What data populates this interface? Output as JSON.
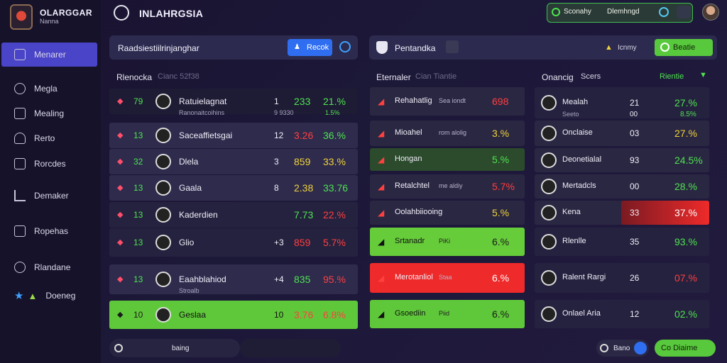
{
  "brand": {
    "title": "OLARGGAR",
    "subtitle": "Nanna"
  },
  "sidebar": {
    "items": [
      {
        "label": "Menarer",
        "icon": "square-icon",
        "active": true
      },
      {
        "label": "Megla",
        "icon": "globe-icon"
      },
      {
        "label": "Mealing",
        "icon": "document-icon"
      },
      {
        "label": "Rerto",
        "icon": "people-icon"
      },
      {
        "label": "Rorcdes",
        "icon": "calendar-icon"
      },
      {
        "label": "Demaker",
        "icon": "chart-icon"
      },
      {
        "label": "Ropehas",
        "icon": "list-icon"
      },
      {
        "label": "Rlandane",
        "icon": "settings-icon"
      },
      {
        "label": "Doeneg",
        "icon": "star-icon"
      }
    ]
  },
  "header": {
    "title": "INLAHRGSIA",
    "pill_label": "Sconahy",
    "pill_value": "Dlemhngd"
  },
  "left_panel": {
    "title": "Raadsiestiilrinjanghar",
    "button": "Recok",
    "section_title": "Rlenocka",
    "section_sub": "Cianc 52f38",
    "rows": [
      {
        "rank": "79",
        "name": "Ratuielagnat",
        "sub": "Ranonaitcoihins",
        "c1": "1",
        "c2": "233",
        "c3": "21.%",
        "sub2": "9 9330",
        "sub3": "1.5%",
        "c2color": "#4ee34f",
        "c3color": "#4ee34f",
        "bg": "#1e1b35"
      },
      {
        "rank": "13",
        "name": "Saceaffietsgai",
        "sub": "",
        "c1": "12",
        "c2": "3.26",
        "c3": "36.%",
        "c2color": "#ff3f3f",
        "c3color": "#4ee34f",
        "bg": "#2e2b4d"
      },
      {
        "rank": "32",
        "name": "Dlela",
        "sub": "",
        "c1": "3",
        "c2": "859",
        "c3": "33.%",
        "c2color": "#f0d23a",
        "c3color": "#f0d23a",
        "bg": "#2e2b4d"
      },
      {
        "rank": "13",
        "name": "Gaala",
        "sub": "",
        "c1": "8",
        "c2": "2.38",
        "c3": "33.76",
        "c2color": "#f0d23a",
        "c3color": "#4ee34f",
        "bg": "#2e2b4d"
      },
      {
        "rank": "13",
        "name": "Kaderdien",
        "sub": "",
        "c1": "",
        "c2": "7.73",
        "c3": "22.%",
        "c2color": "#4ee34f",
        "c3color": "#ff3f3f",
        "bg": "#25223f"
      },
      {
        "rank": "13",
        "name": "Glio",
        "sub": "",
        "c1": "+3",
        "c2": "859",
        "c3": "5.7%",
        "c2color": "#ff3f3f",
        "c3color": "#ff3f3f",
        "bg": "#25223f"
      },
      {
        "rank": "13",
        "name": "Eaahblahiod",
        "sub": "Stroalb",
        "c1": "+4",
        "c2": "835",
        "c3": "95.%",
        "c2color": "#4ee34f",
        "c3color": "#ff3f3f",
        "bg": "#2e2b4d"
      },
      {
        "rank": "10",
        "name": "Geslaa",
        "sub": "",
        "c1": "10",
        "c2": "3.76",
        "c3": "6.8%",
        "c2color": "#ff3f3f",
        "c3color": "#ff3f3f",
        "bg": "#5fc83a"
      }
    ],
    "footer_label": "baing"
  },
  "mid_panel": {
    "title": "Pentandka",
    "section_title": "Eternaler",
    "section_sub": "Cian Tiantie",
    "rows": [
      {
        "name": "Rehahatlig",
        "sub": "Sea iondt",
        "value": "698",
        "color": "#ff3f3f",
        "bg": "#2a2742"
      },
      {
        "name": "Mioahel",
        "sub": "rom alolig",
        "value": "3.%",
        "color": "#f0d23a",
        "bg": "#2a2742"
      },
      {
        "name": "Hongan",
        "sub": "",
        "value": "5.%",
        "color": "#4ee34f",
        "bg": "#2c4a2c"
      },
      {
        "name": "Retalchtel",
        "sub": "me aldiy",
        "value": "5.7%",
        "color": "#ff3f3f",
        "bg": "#2a2742"
      },
      {
        "name": "Oolahbiiooing",
        "sub": "",
        "value": "5.%",
        "color": "#f0d23a",
        "bg": "#2a2742"
      },
      {
        "name": "Srtanadr",
        "sub": "PiKi",
        "value": "6.%",
        "color": "#1a1a1a",
        "bg": "#66cc3a"
      },
      {
        "name": "Merotanliol",
        "sub": "Staa",
        "value": "6.%",
        "color": "#ffffff",
        "bg": "#ee2a2a"
      },
      {
        "name": "Gsoediin",
        "sub": "Piid",
        "value": "6.%",
        "color": "#1a1a1a",
        "bg": "#5fc83a"
      }
    ]
  },
  "right_panel": {
    "warn": "Icnmy",
    "button": "Beatie",
    "section_title": "Onancig",
    "section_sub": "Scers",
    "filter": "Rientie",
    "rows": [
      {
        "name": "Mealah",
        "sub": "Seeto",
        "c1": "21",
        "c1b": "00",
        "c2": "27.%",
        "c2b": "8.5%",
        "color": "#4ee34f",
        "bg": "#25223f"
      },
      {
        "name": "Onclaise",
        "sub": "",
        "c1": "03",
        "c2": "27.%",
        "color": "#f0d23a",
        "bg": "#2a2742"
      },
      {
        "name": "Deonetialal",
        "sub": "",
        "c1": "93",
        "c2": "24.5%",
        "color": "#4ee34f",
        "bg": "#2a2742"
      },
      {
        "name": "Mertadcls",
        "sub": "",
        "c1": "00",
        "c2": "28.%",
        "color": "#4ee34f",
        "bg": "#2a2742"
      },
      {
        "name": "Kena",
        "sub": "",
        "c1": "33",
        "c2": "37.%",
        "color": "#ffffff",
        "bg": "#2a2742",
        "highlight": true
      },
      {
        "name": "Rlenlle",
        "sub": "",
        "c1": "35",
        "c2": "93.%",
        "color": "#4ee34f",
        "bg": "#25223f"
      },
      {
        "name": "Ralent Rargi",
        "sub": "",
        "c1": "26",
        "c2": "07.%",
        "color": "#ff3f3f",
        "bg": "#25223f"
      },
      {
        "name": "Onlael Aria",
        "sub": "",
        "c1": "12",
        "c2": "02.%",
        "color": "#4ee34f",
        "bg": "#25223f"
      }
    ],
    "footer_left": "Bano",
    "footer_button": "Co Diaime"
  }
}
